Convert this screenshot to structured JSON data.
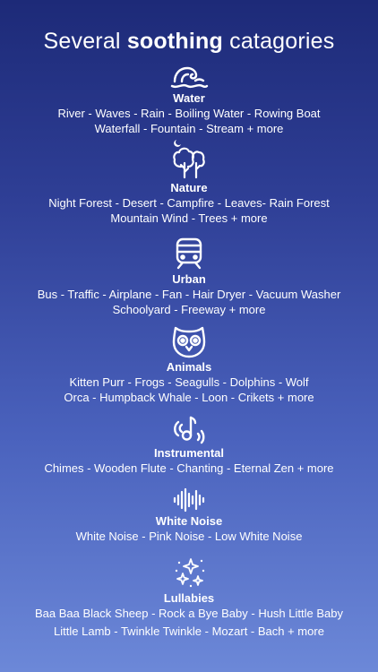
{
  "headline": {
    "pre": "Several ",
    "bold": "soothing",
    "post": " catagories"
  },
  "categories": [
    {
      "title": "Water",
      "icon": "wave-icon",
      "lines": [
        "River - Waves - Rain - Boiling Water  - Rowing Boat",
        "Waterfall - Fountain - Stream + more"
      ]
    },
    {
      "title": "Nature",
      "icon": "tree-moon-icon",
      "lines": [
        "Night Forest - Desert - Campfire - Leaves- Rain Forest",
        "Mountain Wind - Trees + more"
      ]
    },
    {
      "title": "Urban",
      "icon": "train-icon",
      "lines": [
        "Bus - Traffic - Airplane - Fan - Hair Dryer - Vacuum Washer",
        "Schoolyard - Freeway + more"
      ]
    },
    {
      "title": "Animals",
      "icon": "owl-icon",
      "lines": [
        "Kitten Purr - Frogs - Seagulls -  Dolphins - Wolf",
        "Orca - Humpback Whale - Loon - Crikets + more"
      ]
    },
    {
      "title": "Instrumental",
      "icon": "music-note-icon",
      "lines": [
        "Chimes - Wooden Flute - Chanting - Eternal Zen   + more"
      ]
    },
    {
      "title": "White Noise",
      "icon": "sound-wave-icon",
      "lines": [
        "White Noise - Pink Noise  - Low White Noise"
      ]
    },
    {
      "title": "Lullabies",
      "icon": "sparkles-icon",
      "lines": [
        "Baa Baa Black Sheep - Rock a Bye Baby - Hush Little Baby",
        "Little Lamb - Twinkle Twinkle - Mozart - Bach + more"
      ]
    }
  ]
}
